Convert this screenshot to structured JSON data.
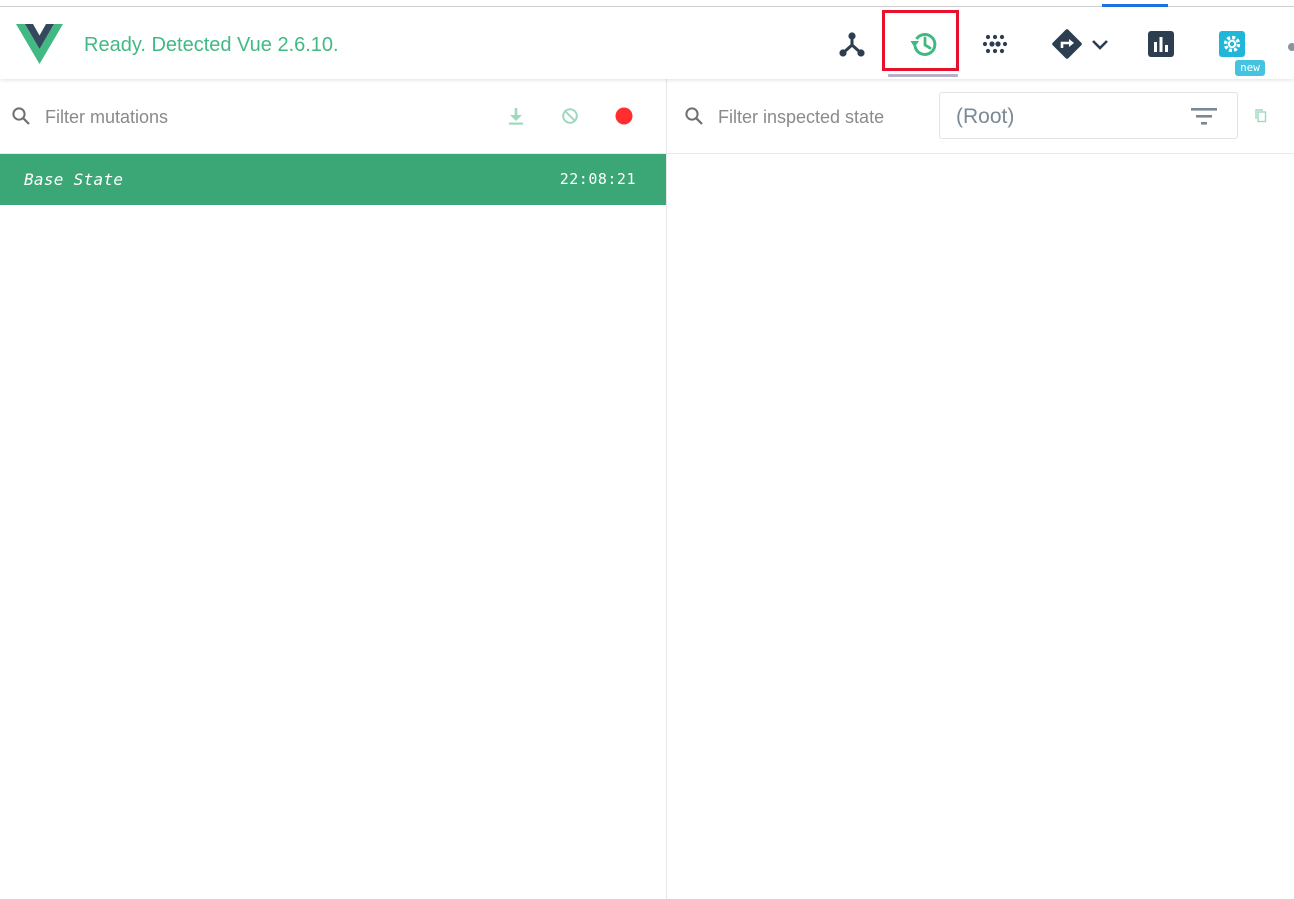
{
  "header": {
    "status": "Ready. Detected Vue 2.6.10.",
    "nav": [
      {
        "name": "components",
        "icon": "component-tree-icon",
        "active": false
      },
      {
        "name": "vuex",
        "icon": "history-icon",
        "active": true
      },
      {
        "name": "events",
        "icon": "events-dots-icon",
        "active": false
      },
      {
        "name": "routing",
        "icon": "routing-directions-icon",
        "active": false,
        "has_dropdown": true
      },
      {
        "name": "performance",
        "icon": "bar-chart-icon",
        "active": false
      },
      {
        "name": "settings",
        "icon": "gear-icon",
        "active": false,
        "badge": "new"
      }
    ],
    "settings_badge": "new"
  },
  "mutations": {
    "filter_placeholder": "Filter mutations",
    "tools": [
      "download-icon",
      "clear-icon",
      "record-icon"
    ],
    "items": [
      {
        "name": "Base State",
        "time": "22:08:21",
        "selected": true
      }
    ]
  },
  "inspector": {
    "filter_placeholder": "Filter inspected state",
    "select_value": "(Root)"
  },
  "colors": {
    "vue_green": "#42b983",
    "selected_row": "#3ba776",
    "record_red": "#ff2d2d",
    "active_box": "#e8112d",
    "badge": "#44c4e0",
    "icon_dark": "#2c3e50"
  }
}
